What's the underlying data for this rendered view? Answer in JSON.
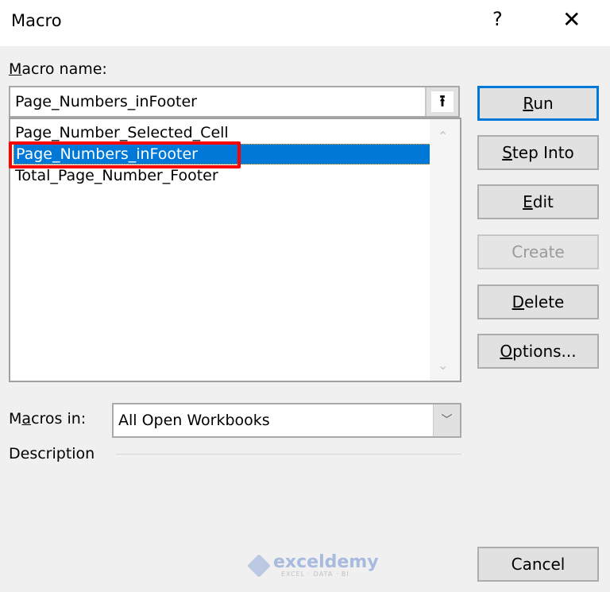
{
  "window": {
    "title": "Macro",
    "help_icon": "?",
    "close_icon": "✕"
  },
  "macro_name": {
    "label_mnemonic": "M",
    "label_rest": "acro name:",
    "value": "Page_Numbers_inFooter",
    "upload_icon": "⭱"
  },
  "macro_list": {
    "items": [
      {
        "label": "Page_Number_Selected_Cell",
        "selected": false
      },
      {
        "label": "Page_Numbers_inFooter",
        "selected": true
      },
      {
        "label": "Total_Page_Number_Footer",
        "selected": false
      }
    ],
    "scroll_up_icon": "⌃",
    "scroll_down_icon": "⌄"
  },
  "buttons": {
    "run": {
      "mn": "R",
      "rest": "un"
    },
    "step_into": {
      "mn": "S",
      "rest": "tep Into"
    },
    "edit": {
      "mn": "E",
      "rest": "dit"
    },
    "create": {
      "label": "Create"
    },
    "delete": {
      "mn": "D",
      "rest": "elete"
    },
    "options": {
      "mn": "O",
      "rest": "ptions..."
    },
    "cancel": {
      "label": "Cancel"
    }
  },
  "macros_in": {
    "label_pre": "M",
    "label_mnemonic": "a",
    "label_rest": "cros in:",
    "value": "All Open Workbooks",
    "dropdown_icon": "﹀"
  },
  "description": {
    "label": "Description"
  },
  "watermark": {
    "name": "exceldemy",
    "tagline": "EXCEL · DATA · BI"
  },
  "colors": {
    "accent": "#0078d7",
    "highlight_box": "#ff0000"
  }
}
